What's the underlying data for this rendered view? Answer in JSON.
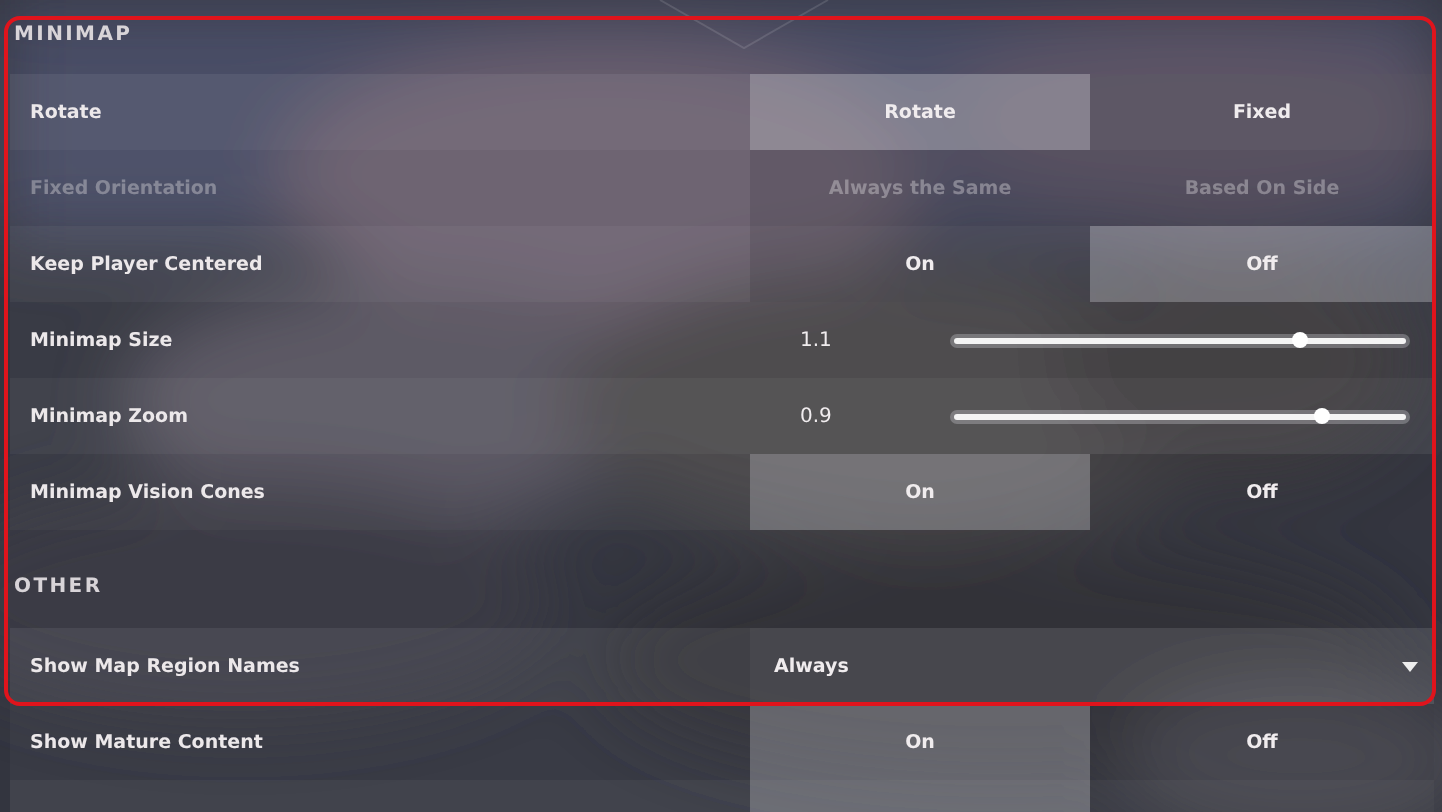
{
  "sections": [
    {
      "title": "MINIMAP",
      "rows": [
        {
          "kind": "toggle",
          "label": "Rotate",
          "disabled": false,
          "options": [
            {
              "label": "Rotate",
              "selected": true
            },
            {
              "label": "Fixed",
              "selected": false
            }
          ]
        },
        {
          "kind": "toggle",
          "label": "Fixed Orientation",
          "disabled": true,
          "options": [
            {
              "label": "Always the Same",
              "selected": false
            },
            {
              "label": "Based On Side",
              "selected": false
            }
          ]
        },
        {
          "kind": "toggle",
          "label": "Keep Player Centered",
          "disabled": false,
          "options": [
            {
              "label": "On",
              "selected": false
            },
            {
              "label": "Off",
              "selected": true
            }
          ]
        },
        {
          "kind": "slider",
          "label": "Minimap Size",
          "reading": "1.1",
          "level": 0.76
        },
        {
          "kind": "slider",
          "label": "Minimap Zoom",
          "reading": "0.9",
          "level": 0.81
        },
        {
          "kind": "toggle",
          "label": "Minimap Vision Cones",
          "disabled": false,
          "options": [
            {
              "label": "On",
              "selected": true
            },
            {
              "label": "Off",
              "selected": false
            }
          ]
        }
      ]
    },
    {
      "title": "OTHER",
      "rows": [
        {
          "kind": "dropdown",
          "label": "Show Map Region Names",
          "value": "Always"
        },
        {
          "kind": "toggle",
          "label": "Show Mature Content",
          "disabled": false,
          "options": [
            {
              "label": "On",
              "selected": true
            },
            {
              "label": "Off",
              "selected": false
            }
          ]
        },
        {
          "kind": "cut_off",
          "options": [
            {
              "selected": true
            },
            {
              "selected": false
            }
          ]
        }
      ]
    }
  ]
}
